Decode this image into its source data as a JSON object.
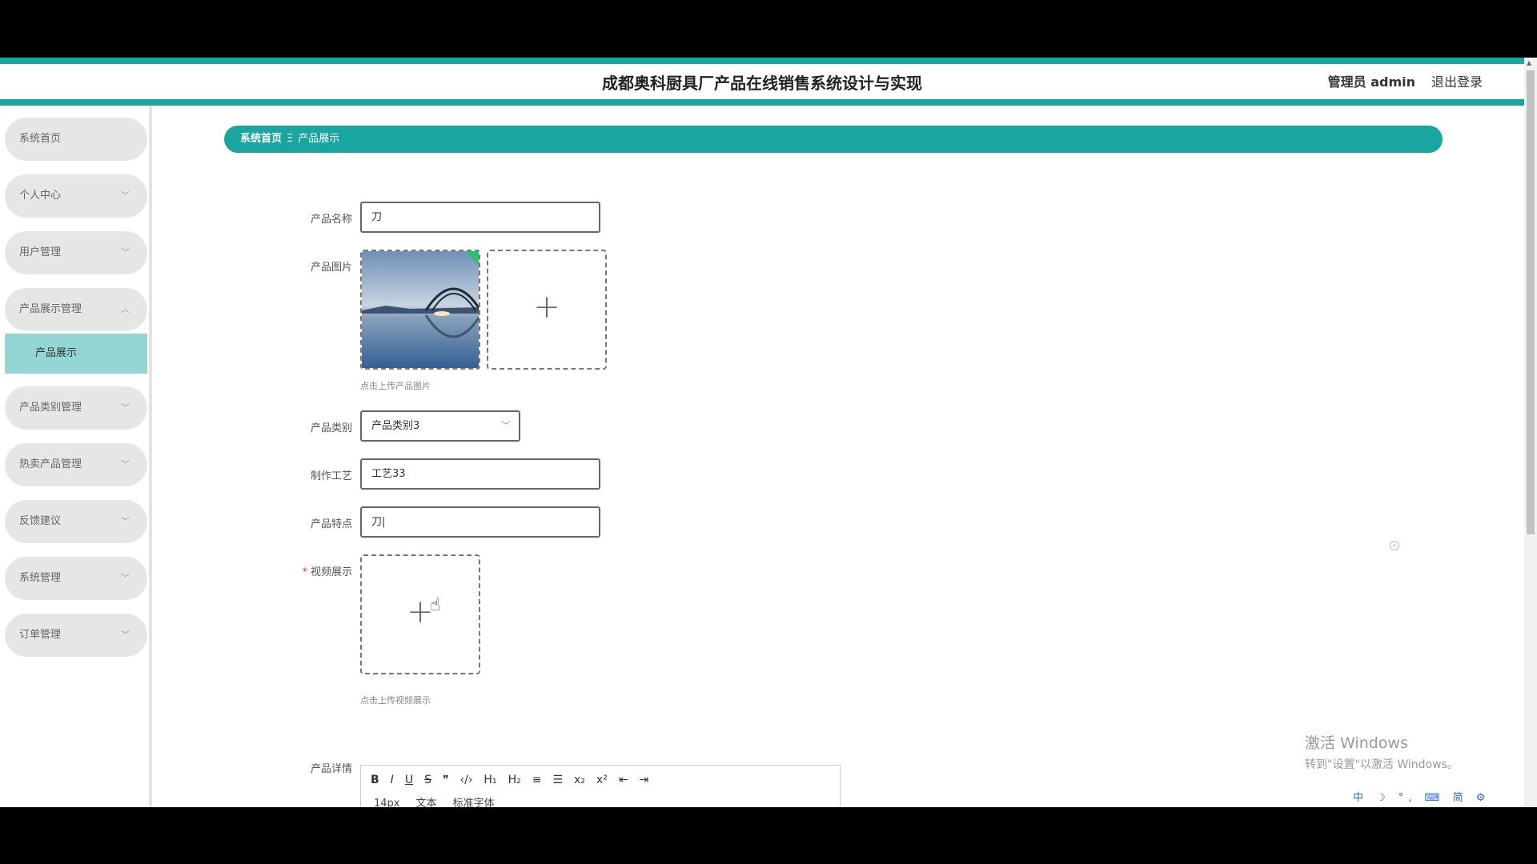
{
  "header": {
    "title": "成都奥科厨具厂产品在线销售系统设计与实现",
    "admin_label": "管理员 admin",
    "logout_label": "退出登录"
  },
  "sidebar": {
    "items": [
      {
        "label": "系统首页"
      },
      {
        "label": "个人中心"
      },
      {
        "label": "用户管理"
      },
      {
        "label": "产品展示管理"
      },
      {
        "label": "产品展示"
      },
      {
        "label": "产品类别管理"
      },
      {
        "label": "热卖产品管理"
      },
      {
        "label": "反馈建议"
      },
      {
        "label": "系统管理"
      },
      {
        "label": "订单管理"
      }
    ]
  },
  "breadcrumb": {
    "home": "系统首页",
    "separator": "Ξ",
    "current": "产品展示"
  },
  "form": {
    "name_label": "产品名称",
    "name_value": "刀",
    "image_label": "产品图片",
    "image_hint": "点击上传产品图片",
    "category_label": "产品类别",
    "category_value": "产品类别3",
    "craft_label": "制作工艺",
    "craft_value": "工艺33",
    "feature_label": "产品特点",
    "feature_value": "刀|",
    "video_label": "视频展示",
    "video_required_mark": "*",
    "video_hint": "点击上传视频展示",
    "detail_label": "产品详情"
  },
  "editor": {
    "toolbar_row1": [
      "B",
      "I",
      "U",
      "S",
      "❞",
      "‹/›",
      "H₁",
      "H₂",
      "≡",
      "☰",
      "x₂",
      "x²",
      "⇤",
      "⇥"
    ],
    "font_size": "14px",
    "text_type": "文本",
    "font_family": "标准字体"
  },
  "watermark": {
    "line1": "激活 Windows",
    "line2": "转到\"设置\"以激活 Windows。"
  },
  "tray": {
    "text": "中 ☽ °, ⌨ 简 ⚙"
  },
  "colors": {
    "accent": "#1aa5a0",
    "submenu_active": "#93d6d3"
  }
}
